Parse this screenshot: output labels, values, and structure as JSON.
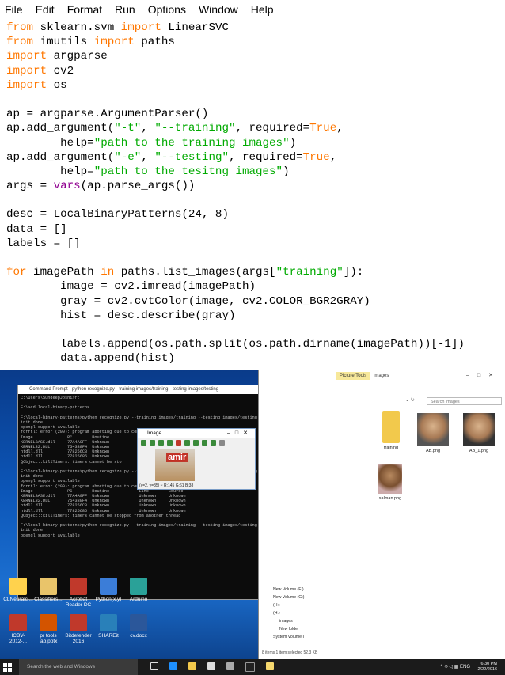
{
  "menu": [
    "File",
    "Edit",
    "Format",
    "Run",
    "Options",
    "Window",
    "Help"
  ],
  "code": [
    [
      [
        "kw",
        "from"
      ],
      [
        "n",
        " sklearn.svm "
      ],
      [
        "kw",
        "import"
      ],
      [
        "n",
        " LinearSVC"
      ]
    ],
    [
      [
        "kw",
        "from"
      ],
      [
        "n",
        " imutils "
      ],
      [
        "kw",
        "import"
      ],
      [
        "n",
        " paths"
      ]
    ],
    [
      [
        "kw",
        "import"
      ],
      [
        "n",
        " argparse"
      ]
    ],
    [
      [
        "kw",
        "import"
      ],
      [
        "n",
        " cv2"
      ]
    ],
    [
      [
        "kw",
        "import"
      ],
      [
        "n",
        " os"
      ]
    ],
    [
      [
        "n",
        ""
      ]
    ],
    [
      [
        "n",
        "ap = argparse.ArgumentParser()"
      ]
    ],
    [
      [
        "n",
        "ap.add_argument("
      ],
      [
        "st",
        "\"-t\""
      ],
      [
        "n",
        ", "
      ],
      [
        "st",
        "\"--training\""
      ],
      [
        "n",
        ", required="
      ],
      [
        "kw",
        "True"
      ],
      [
        "n",
        ","
      ]
    ],
    [
      [
        "n",
        "        help="
      ],
      [
        "st",
        "\"path to the training images\""
      ],
      [
        "n",
        ")"
      ]
    ],
    [
      [
        "n",
        "ap.add_argument("
      ],
      [
        "st",
        "\"-e\""
      ],
      [
        "n",
        ", "
      ],
      [
        "st",
        "\"--testing\""
      ],
      [
        "n",
        ", required="
      ],
      [
        "kw",
        "True"
      ],
      [
        "n",
        ","
      ]
    ],
    [
      [
        "n",
        "        help="
      ],
      [
        "st",
        "\"path to the tesitng images\""
      ],
      [
        "n",
        ")"
      ]
    ],
    [
      [
        "n",
        "args = "
      ],
      [
        "bi",
        "vars"
      ],
      [
        "n",
        "(ap.parse_args())"
      ]
    ],
    [
      [
        "n",
        ""
      ]
    ],
    [
      [
        "n",
        "desc = LocalBinaryPatterns(24, 8)"
      ]
    ],
    [
      [
        "n",
        "data = []"
      ]
    ],
    [
      [
        "n",
        "labels = []"
      ]
    ],
    [
      [
        "n",
        ""
      ]
    ],
    [
      [
        "kw",
        "for"
      ],
      [
        "n",
        " imagePath "
      ],
      [
        "kw",
        "in"
      ],
      [
        "n",
        " paths.list_images(args["
      ],
      [
        "st",
        "\"training\""
      ],
      [
        "n",
        "]):"
      ]
    ],
    [
      [
        "n",
        "        image = cv2.imread(imagePath)"
      ]
    ],
    [
      [
        "n",
        "        gray = cv2.cvtColor(image, cv2.COLOR_BGR2GRAY)"
      ]
    ],
    [
      [
        "n",
        "        hist = desc.describe(gray)"
      ]
    ],
    [
      [
        "n",
        ""
      ]
    ],
    [
      [
        "n",
        "        labels.append(os.path.split(os.path.dirname(imagePath))[-1])"
      ]
    ],
    [
      [
        "n",
        "        data.append(hist)"
      ]
    ]
  ],
  "cmd": {
    "title": "Command Prompt - python recognize.py --training images/training --testing images/testing",
    "lines": [
      "C:\\Users\\SundeepJoshi>f:",
      "",
      "F:\\>cd local-binary-patterns",
      "",
      "F:\\local-binary-patterns>python recognize.py --training images/training --testing images/testing",
      "init done",
      "opengl support available",
      "forrtl: error (200): program aborting due to control-C event",
      "Image              PC        Routine",
      "KERNELBASE.dll     77A4A9FF  Unknown",
      "KERNEL32.DLL       754338F4  Unknown",
      "ntdll.dll          778256C3  Unknown",
      "ntdll.dll          77825686  Unknown",
      "QObject::killTimers: timers cannot be sto",
      "",
      "F:\\local-binary-patterns>python recognize.py --training images/training --testing images/testing",
      "init done",
      "opengl support available",
      "forrtl: error (200): program aborting due to control-C event",
      "Image              PC        Routine            Line        Source",
      "KERNELBASE.dll     77A4A9FF  Unknown            Unknown     Unknown",
      "KERNEL32.DLL       754338F4  Unknown            Unknown     Unknown",
      "ntdll.dll          778256C3  Unknown            Unknown     Unknown",
      "ntdll.dll          77825686  Unknown            Unknown     Unknown",
      "QObject::killTimers: timers cannot be stopped from another thread",
      "",
      "F:\\local-binary-patterns>python recognize.py --training images/training --testing images/testing",
      "init done",
      "opengl support available"
    ]
  },
  "image_window": {
    "title": "Image",
    "overlay_text": "amir",
    "status": "(x=2, y=35) ~ R:145 G:61 B:38"
  },
  "explorer": {
    "ribbon_tab": "Picture Tools",
    "folder_name": "images",
    "search_placeholder": "Search images",
    "items": [
      {
        "label": "training"
      },
      {
        "label": "AB.png"
      },
      {
        "label": "AB_1.png"
      },
      {
        "label": "salman.png"
      }
    ],
    "tree": [
      "New Volume (F:)",
      "New Volume (G:)",
      "(H:)",
      "(H:)",
      "images",
      "New folder",
      "System Volume I"
    ],
    "status": "8 items    1 item selected  52.3 KB"
  },
  "desktop_icons": [
    {
      "label": "CLNeuralcl..."
    },
    {
      "label": "Classifiers..."
    },
    {
      "label": "Acrobat Reader DC"
    },
    {
      "label": "Python(x,y)"
    },
    {
      "label": "Arduino"
    },
    {
      "label": "ICBV-2012-..."
    },
    {
      "label": "pr tools lab.pptx"
    },
    {
      "label": "Bitdefender 2016"
    },
    {
      "label": "SHAREit"
    },
    {
      "label": "cv.docx"
    }
  ],
  "taskbar": {
    "search_placeholder": "Search the web and Windows",
    "lang": "ENG",
    "time": "6:30 PM",
    "date": "2/22/2016"
  },
  "colors": {
    "keyword": "#ff7700",
    "string": "#00aa00",
    "builtin": "#900090"
  }
}
